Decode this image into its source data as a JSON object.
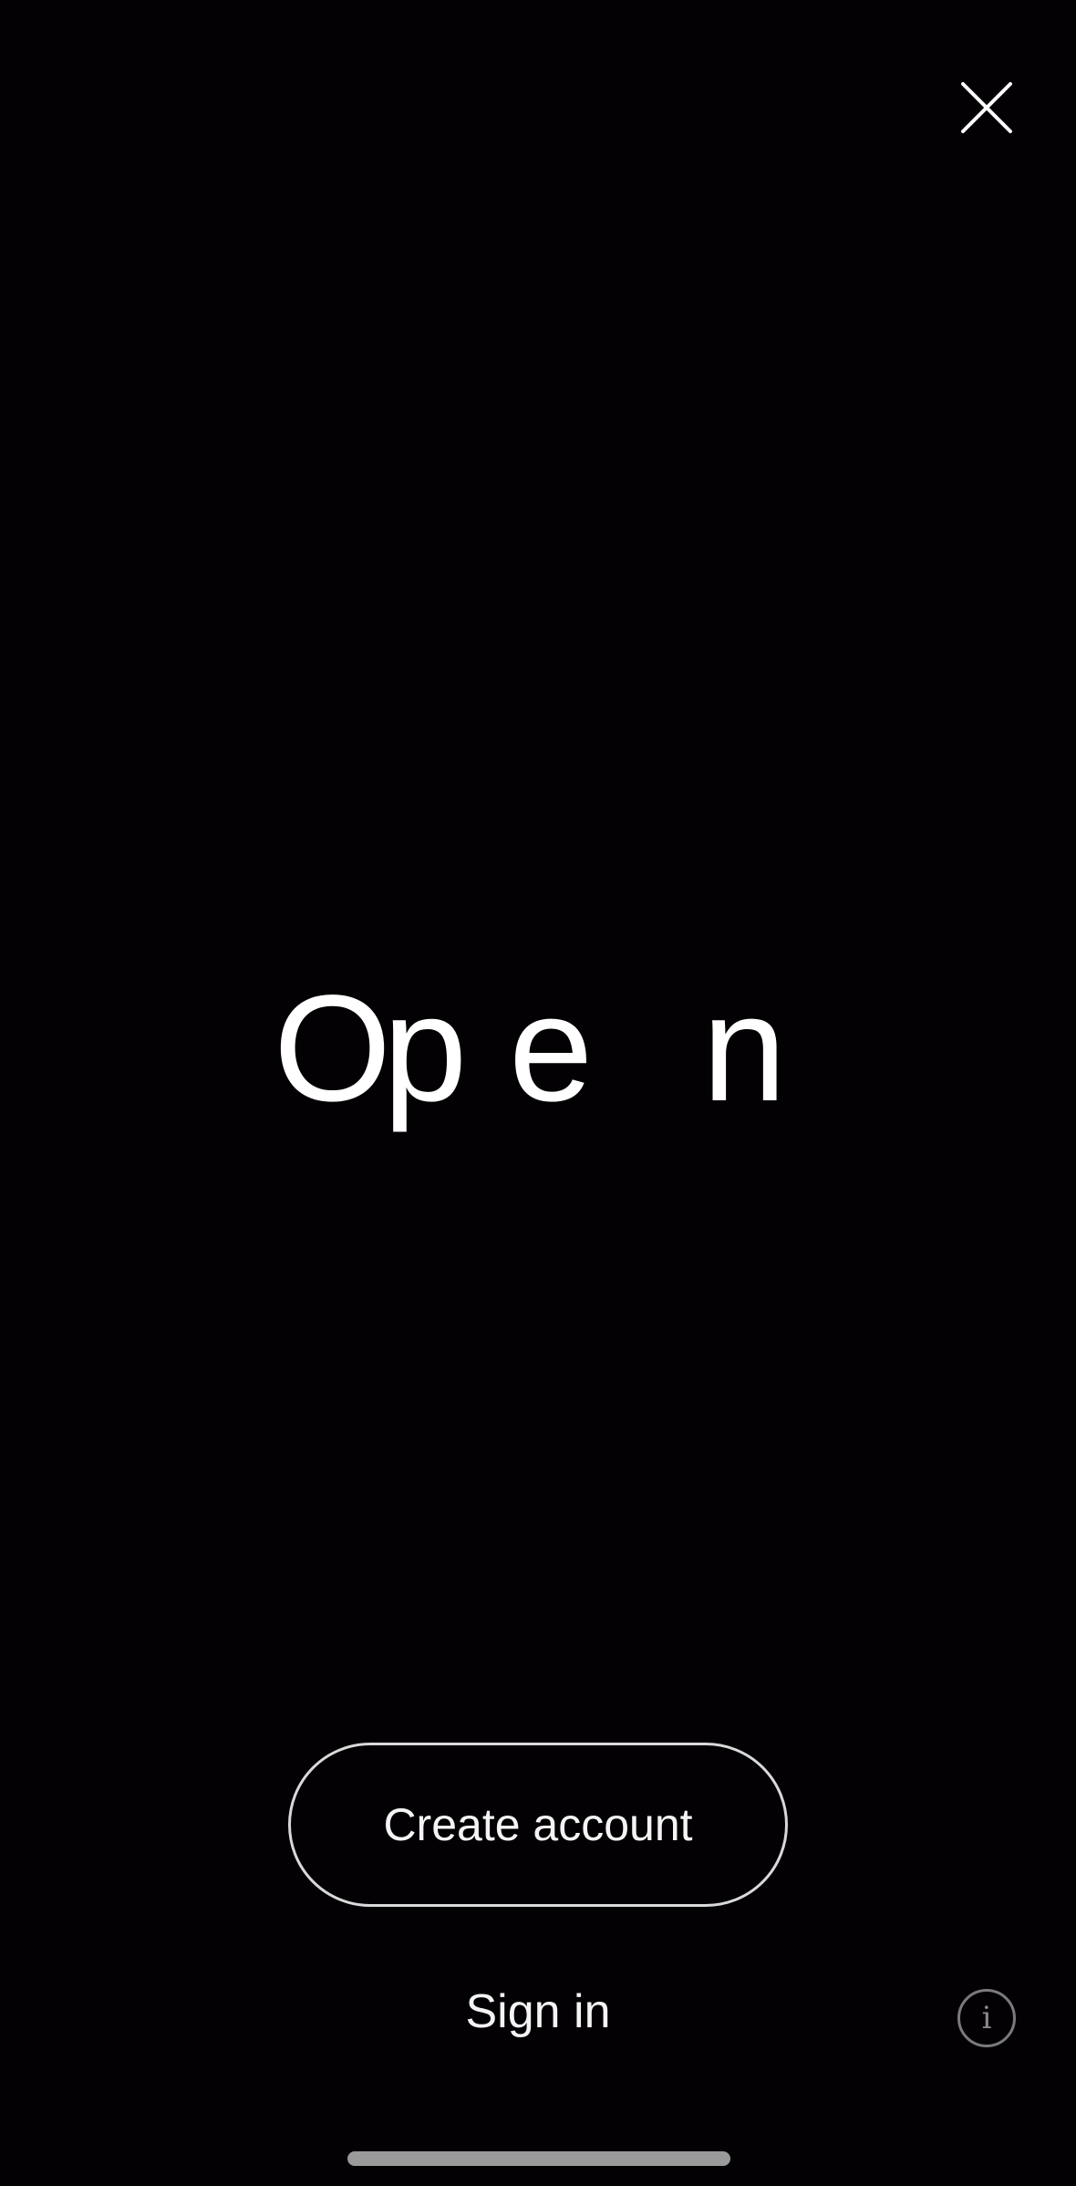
{
  "header": {
    "close_icon": "close-icon"
  },
  "logo": {
    "letters": [
      "O",
      "p",
      "e",
      "n"
    ],
    "color": "#ffffff"
  },
  "actions": {
    "create_account_label": "Create account",
    "sign_in_label": "Sign in"
  },
  "footer": {
    "info_icon": "info-icon",
    "info_glyph": "i"
  },
  "colors": {
    "background": "#030104",
    "text": "#ffffff",
    "button_border": "#d9d9d9",
    "info_border": "#7a7a7a"
  }
}
